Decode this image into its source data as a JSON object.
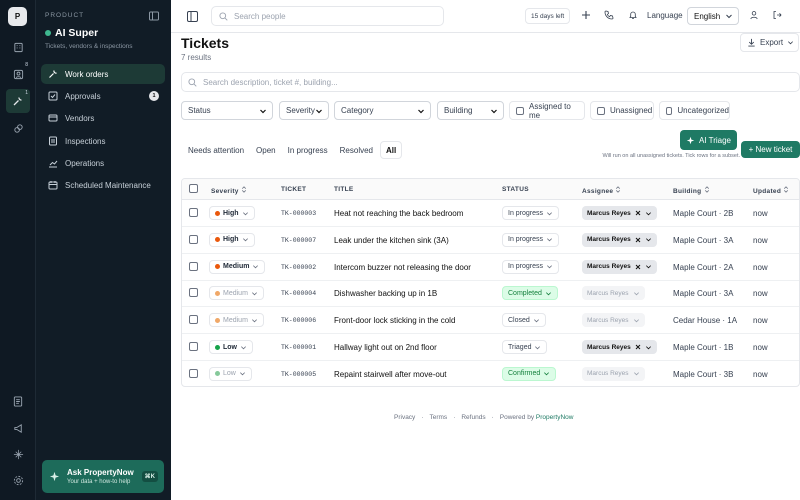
{
  "rail": {
    "logo": "P",
    "badges": {
      "tenants": "8",
      "work": "1"
    }
  },
  "sidebar": {
    "product_label": "PRODUCT",
    "org_name": "AI Super",
    "org_sub": "Tickets, vendors & inspections",
    "items": [
      {
        "label": "Work orders",
        "icon": "wrench-icon"
      },
      {
        "label": "Approvals",
        "icon": "checkbox-icon",
        "count": "1"
      },
      {
        "label": "Vendors",
        "icon": "truck-icon"
      },
      {
        "label": "Inspections",
        "icon": "clipboard-icon"
      },
      {
        "label": "Operations",
        "icon": "chart-icon"
      },
      {
        "label": "Scheduled Maintenance",
        "icon": "calendar-icon"
      }
    ],
    "ask": {
      "title": "Ask PropertyNow",
      "subtitle": "Your data + how-to help",
      "shortcut": "⌘K"
    }
  },
  "topbar": {
    "search_placeholder": "Search people",
    "trial": "15 days left",
    "language_label": "Language",
    "language_value": "English"
  },
  "page": {
    "title": "Tickets",
    "results": "7 results",
    "export_label": "Export",
    "search_placeholder": "Search description, ticket #, building..."
  },
  "filters": {
    "status": "Status",
    "severity": "Severity",
    "category": "Category",
    "building": "Building",
    "assigned_to_me": "Assigned to me",
    "unassigned": "Unassigned",
    "uncategorized": "Uncategorized"
  },
  "actions": {
    "ai_triage": "AI Triage",
    "new_ticket": "+ New ticket",
    "hint": "Will run on all unassigned tickets. Tick rows for a subset."
  },
  "tabs": [
    "Needs attention",
    "Open",
    "In progress",
    "Resolved",
    "All"
  ],
  "table": {
    "headers": {
      "severity": "Severity",
      "ticket": "TICKET",
      "title": "TITLE",
      "status": "STATUS",
      "assignee": "Assignee",
      "building": "Building",
      "updated": "Updated"
    },
    "rows": [
      {
        "severity": "High",
        "sev_color": "#ea580c",
        "dim": false,
        "ticket": "TK-000003",
        "title": "Heat not reaching the back bedroom",
        "status": "In progress",
        "green": false,
        "assignee": "Marcus Reyes",
        "assigned": true,
        "building": "Maple Court · 2B",
        "updated": "now"
      },
      {
        "severity": "High",
        "sev_color": "#ea580c",
        "dim": false,
        "ticket": "TK-000007",
        "title": "Leak under the kitchen sink (3A)",
        "status": "In progress",
        "green": false,
        "assignee": "Marcus Reyes",
        "assigned": true,
        "building": "Maple Court · 3A",
        "updated": "now"
      },
      {
        "severity": "Medium",
        "sev_color": "#ea580c",
        "dim": false,
        "ticket": "TK-000002",
        "title": "Intercom buzzer not releasing the door",
        "status": "In progress",
        "green": false,
        "assignee": "Marcus Reyes",
        "assigned": true,
        "building": "Maple Court · 2A",
        "updated": "now"
      },
      {
        "severity": "Medium",
        "sev_color": "#f0a868",
        "dim": true,
        "ticket": "TK-000004",
        "title": "Dishwasher backing up in 1B",
        "status": "Completed",
        "green": true,
        "assignee": "Marcus Reyes",
        "assigned": false,
        "building": "Maple Court · 3A",
        "updated": "now"
      },
      {
        "severity": "Medium",
        "sev_color": "#f0a868",
        "dim": true,
        "ticket": "TK-000006",
        "title": "Front-door lock sticking in the cold",
        "status": "Closed",
        "green": false,
        "assignee": "Marcus Reyes",
        "assigned": false,
        "building": "Cedar House · 1A",
        "updated": "now"
      },
      {
        "severity": "Low",
        "sev_color": "#16a34a",
        "dim": false,
        "ticket": "TK-000001",
        "title": "Hallway light out on 2nd floor",
        "status": "Triaged",
        "green": false,
        "assignee": "Marcus Reyes",
        "assigned": true,
        "building": "Maple Court · 1B",
        "updated": "now"
      },
      {
        "severity": "Low",
        "sev_color": "#86c99a",
        "dim": true,
        "ticket": "TK-000005",
        "title": "Repaint stairwell after move-out",
        "status": "Confirmed",
        "green": true,
        "assignee": "Marcus Reyes",
        "assigned": false,
        "building": "Maple Court · 3B",
        "updated": "now"
      }
    ]
  },
  "footer": {
    "privacy": "Privacy",
    "terms": "Terms",
    "refunds": "Refunds",
    "powered": "Powered by",
    "brand": "PropertyNow"
  }
}
